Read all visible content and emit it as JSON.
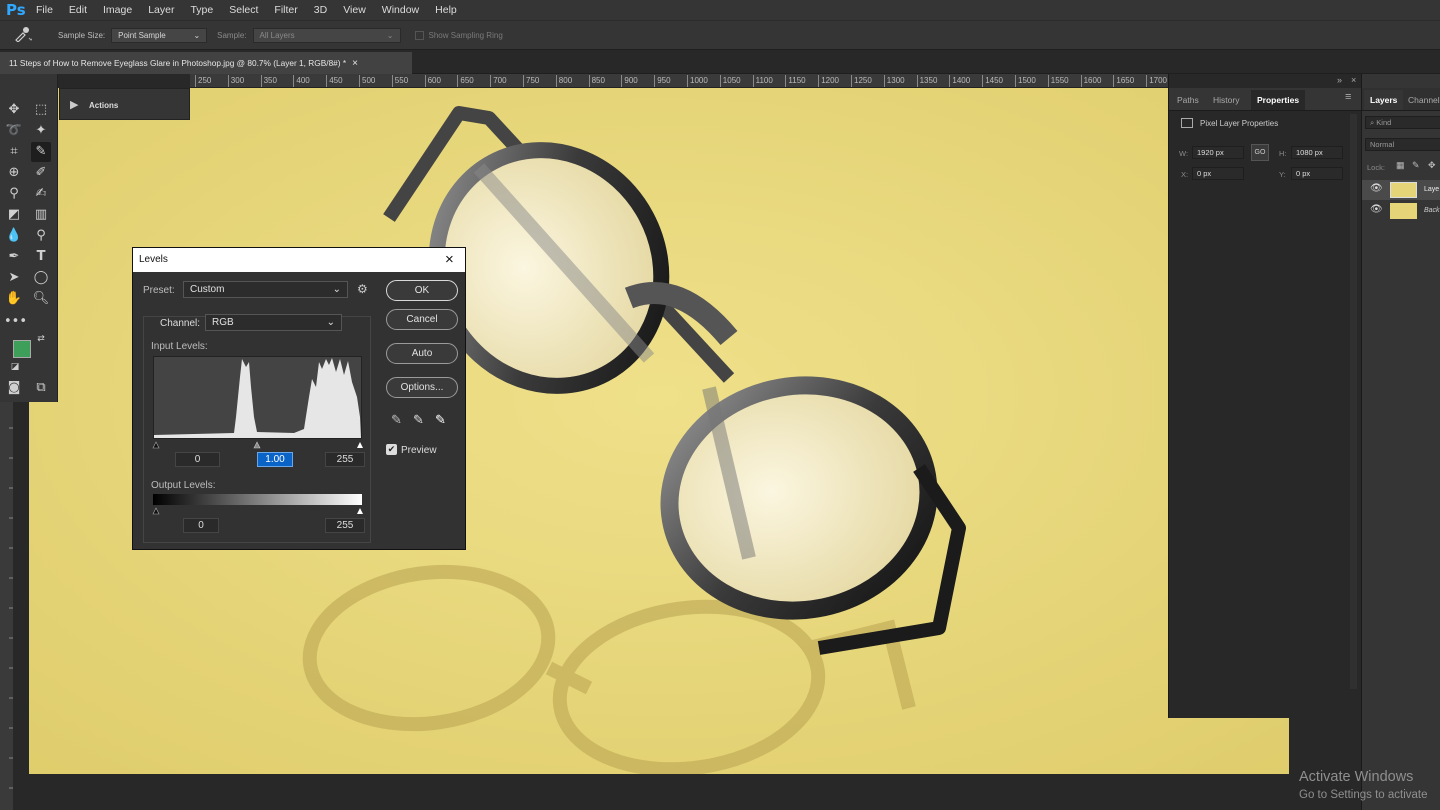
{
  "app": {
    "logo": "Ps"
  },
  "menu": [
    "File",
    "Edit",
    "Image",
    "Layer",
    "Type",
    "Select",
    "Filter",
    "3D",
    "View",
    "Window",
    "Help"
  ],
  "options": {
    "tool_icon": "eyedropper-icon",
    "sample_size_label": "Sample Size:",
    "sample_size_value": "Point Sample",
    "sample_label": "Sample:",
    "sample_value": "All Layers",
    "sampling_ring_label": "Show Sampling Ring"
  },
  "document": {
    "tab_title": "11 Steps of How to Remove Eyeglass Glare in Photoshop.jpg @ 80.7% (Layer 1, RGB/8#) *",
    "close": "×"
  },
  "ruler": {
    "h_labels": [
      "250",
      "300",
      "350",
      "400",
      "450",
      "500",
      "550",
      "600",
      "650",
      "700",
      "750",
      "800",
      "850",
      "900",
      "950",
      "1000",
      "1050",
      "1100",
      "1150",
      "1200",
      "1250",
      "1300",
      "1350",
      "1400",
      "1450",
      "1500",
      "1550",
      "1600",
      "1650",
      "1700"
    ]
  },
  "actions_panel": {
    "label": "Actions"
  },
  "colors": {
    "foreground": "#3e9f5b",
    "background": "#000000",
    "canvas": "#e6d478",
    "accent": "#0a64c8"
  },
  "properties": {
    "tabs": [
      "Paths",
      "History",
      "Properties"
    ],
    "active_tab": "Properties",
    "section": "Pixel Layer Properties",
    "w_label": "W:",
    "w_value": "1920 px",
    "h_label": "H:",
    "h_value": "1080 px",
    "x_label": "X:",
    "x_value": "0 px",
    "y_label": "Y:",
    "y_value": "0 px",
    "link": "GO"
  },
  "layers": {
    "tabs": [
      "Layers",
      "Channels"
    ],
    "search": "Kind",
    "blend": "Normal",
    "lock_label": "Lock:",
    "items": [
      {
        "name": "Laye"
      },
      {
        "name": "Back"
      }
    ]
  },
  "levels": {
    "title": "Levels",
    "close": "×",
    "preset_label": "Preset:",
    "preset_value": "Custom",
    "channel_label": "Channel:",
    "channel_value": "RGB",
    "input_levels_label": "Input Levels:",
    "input_black": "0",
    "input_gamma": "1.00",
    "input_white": "255",
    "output_levels_label": "Output Levels:",
    "output_black": "0",
    "output_white": "255",
    "buttons": {
      "ok": "OK",
      "cancel": "Cancel",
      "auto": "Auto",
      "options": "Options..."
    },
    "preview_label": "Preview",
    "preview_checked": true
  },
  "watermark": {
    "line1": "Activate Windows",
    "line2": "Go to Settings to activate"
  }
}
